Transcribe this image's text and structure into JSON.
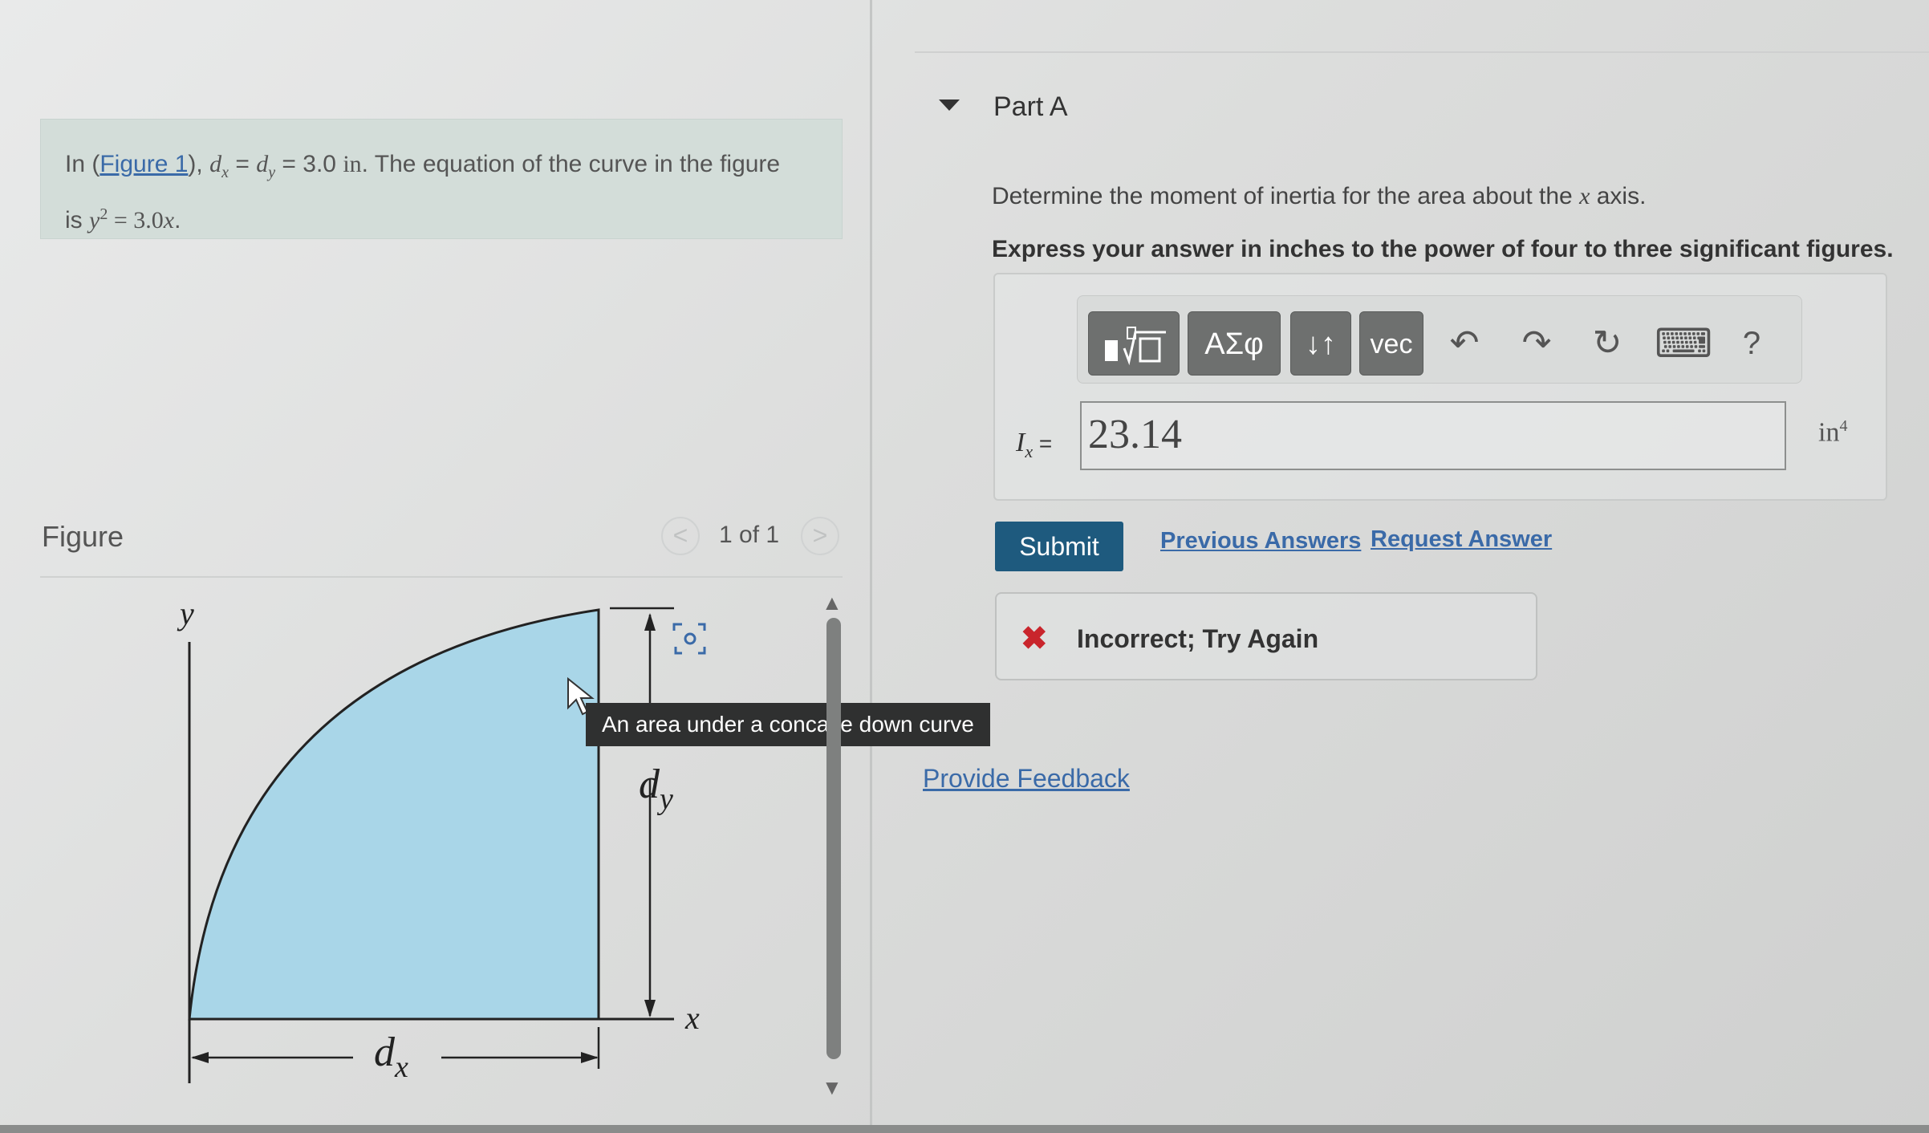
{
  "problem": {
    "prefix": "In (",
    "figure_link": "Figure 1",
    "mid": "), ",
    "dx": "d",
    "dx_sub": "x",
    "eq1": " = ",
    "dy": "d",
    "dy_sub": "y",
    "eq2": " = 3.0 ",
    "unit_in": "in",
    "sentence_rest": ". The equation of the curve in the figure",
    "line2_prefix": "is ",
    "curve_var": "y",
    "curve_exp": "2",
    "curve_rhs": " = 3.0",
    "curve_x": "x",
    "curve_end": "."
  },
  "figure": {
    "title": "Figure",
    "pager_prev": "<",
    "pager_text": "1 of 1",
    "pager_next": ">",
    "tooltip": "An area under a concave down curve",
    "label_y": "y",
    "label_x": "x",
    "label_dx": "d",
    "label_dx_sub": "x",
    "label_dy": "d",
    "label_dy_sub": "y",
    "fill_color": "#a9d6e8",
    "scroll_up": "▲",
    "scroll_down": "▼"
  },
  "part": {
    "title": "Part A",
    "question_prefix": "Determine the moment of inertia for the area about the ",
    "question_var": "x",
    "question_suffix": " axis.",
    "instruction": "Express your answer in inches to the power of four to three significant figures."
  },
  "toolbar": {
    "templates_icon": "templates-icon",
    "greek_label": "ΑΣφ",
    "arrows_label": "↓↑",
    "vec_label": "vec",
    "undo_icon": "↶",
    "redo_icon": "↷",
    "reset_icon": "↻",
    "keyboard_icon": "⌨",
    "help_label": "?"
  },
  "answer": {
    "var": "I",
    "var_sub": "x",
    "equals": " =",
    "value": "23.14",
    "unit": "in",
    "unit_exp": "4"
  },
  "actions": {
    "submit_label": "Submit",
    "previous_answers": "Previous Answers",
    "request_answer": "Request Answer"
  },
  "feedback": {
    "icon": "✖",
    "text": "Incorrect; Try Again",
    "provide_feedback": "Provide Feedback"
  },
  "colors": {
    "submit_bg": "#1e5a7e",
    "link": "#3a6aa8",
    "error": "#c9252c"
  }
}
